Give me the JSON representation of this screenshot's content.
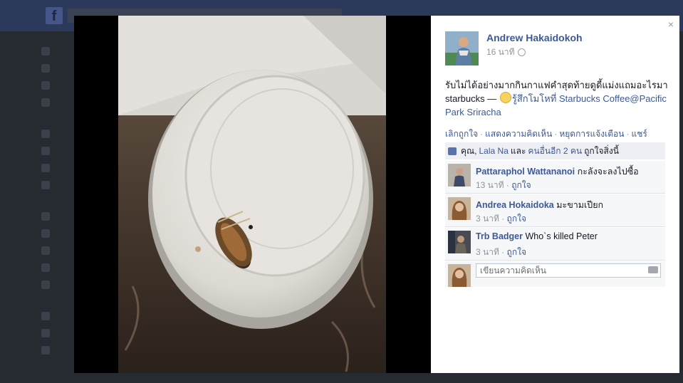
{
  "post": {
    "author": "Andrew Hakaidokoh",
    "time": "16 นาที",
    "text_prefix": "รับไม่ได้อย่างมากกินกาแฟคำสุดท้ายดูดี้แม่งแถมอะไรมา starbucks — ",
    "feeling": "รู้สึกโมโหที่",
    "place": "Starbucks Coffee@Pacific Park Sriracha"
  },
  "actions": {
    "unlike": "เลิกถูกใจ",
    "comment": "แสดงความคิดเห็น",
    "stop_notify": "หยุดการแจ้งเตือน",
    "share": "แชร์"
  },
  "likes": {
    "you": "คุณ,",
    "friend": "Lala Na",
    "and": "และ",
    "others": "คนอื่นอีก 2 คน",
    "suffix": "ถูกใจสิ่งนี้"
  },
  "comments": [
    {
      "name": "Pattaraphol Wattananoi",
      "text": "กะลังจะลงไปซื้อ",
      "time": "13 นาที",
      "like": "ถูกใจ"
    },
    {
      "name": "Andrea Hokaidoka",
      "text": "มะขามเปียก",
      "time": "3 นาที",
      "like": "ถูกใจ"
    },
    {
      "name": "Trb Badger",
      "text": "Who`s killed Peter",
      "time": "3 นาที",
      "like": "ถูกใจ"
    }
  ],
  "composer": {
    "placeholder": "เขียนความคิดเห็น"
  },
  "close_glyph": "×",
  "dot_sep": "·"
}
